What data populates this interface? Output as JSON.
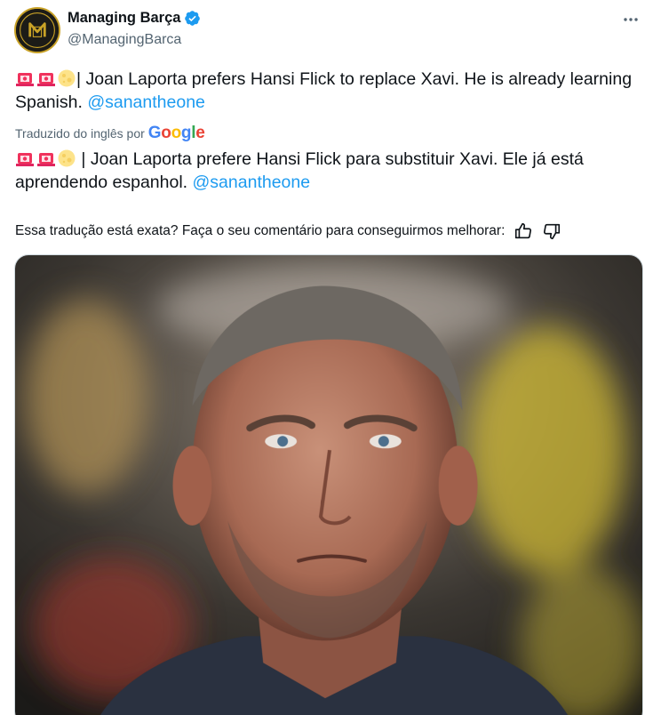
{
  "author": {
    "display_name": "Managing Barça",
    "handle": "@ManagingBarca",
    "avatar_text": "MB"
  },
  "more_icon": "more-horizontal-icon",
  "original_text": {
    "emoji": [
      "siren",
      "siren",
      "moon"
    ],
    "body": "| Joan Laporta prefers Hansi Flick to replace Xavi. He is already learning Spanish. ",
    "mention": "@sanantheone"
  },
  "translation": {
    "label": "Traduzido do inglês por",
    "provider": "Google",
    "body": " | Joan Laporta prefere Hansi Flick para substituir Xavi. Ele já está aprendendo espanhol. ",
    "mention": "@sanantheone"
  },
  "feedback": {
    "prompt": "Essa tradução está exata? Faça o seu comentário para conseguirmos melhorar:",
    "thumbs_up_icon": "thumbs-up-icon",
    "thumbs_down_icon": "thumbs-down-icon"
  },
  "colors": {
    "link": "#1d9bf0",
    "secondary_text": "#536471",
    "verified": "#1d9bf0"
  }
}
